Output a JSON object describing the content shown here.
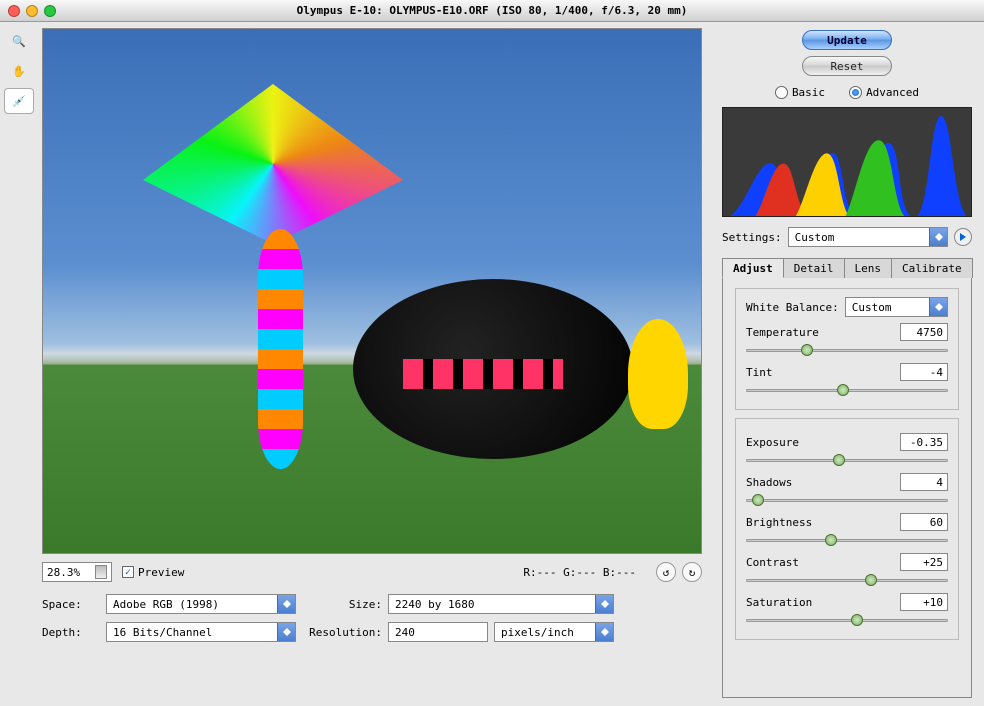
{
  "title": "Olympus E-10:  OLYMPUS-E10.ORF  (ISO 80, 1/400, f/6.3, 20 mm)",
  "tools": {
    "zoom": "zoom-icon",
    "hand": "hand-icon",
    "eyedropper": "eyedropper-icon"
  },
  "zoom": {
    "value": "28.3%"
  },
  "preview_checkbox": {
    "label": "Preview",
    "checked": true
  },
  "rgb_readout": "R:---  G:---  B:---",
  "bottom": {
    "space_label": "Space:",
    "space_value": "Adobe RGB (1998)",
    "size_label": "Size:",
    "size_value": "2240 by 1680",
    "depth_label": "Depth:",
    "depth_value": "16 Bits/Channel",
    "res_label": "Resolution:",
    "res_value": "240",
    "res_units": "pixels/inch"
  },
  "buttons": {
    "update": "Update",
    "reset": "Reset"
  },
  "mode": {
    "basic": "Basic",
    "advanced": "Advanced",
    "selected": "advanced"
  },
  "settings": {
    "label": "Settings:",
    "value": "Custom"
  },
  "tabs": {
    "adjust": "Adjust",
    "detail": "Detail",
    "lens": "Lens",
    "calibrate": "Calibrate",
    "active": "adjust"
  },
  "adjust": {
    "wb_label": "White Balance:",
    "wb_value": "Custom",
    "temperature": {
      "label": "Temperature",
      "value": "4750",
      "pos": 30
    },
    "tint": {
      "label": "Tint",
      "value": "-4",
      "pos": 48
    },
    "exposure": {
      "label": "Exposure",
      "value": "-0.35",
      "pos": 46
    },
    "shadows": {
      "label": "Shadows",
      "value": "4",
      "pos": 6
    },
    "brightness": {
      "label": "Brightness",
      "value": "60",
      "pos": 42
    },
    "contrast": {
      "label": "Contrast",
      "value": "+25",
      "pos": 62
    },
    "saturation": {
      "label": "Saturation",
      "value": "+10",
      "pos": 55
    }
  }
}
